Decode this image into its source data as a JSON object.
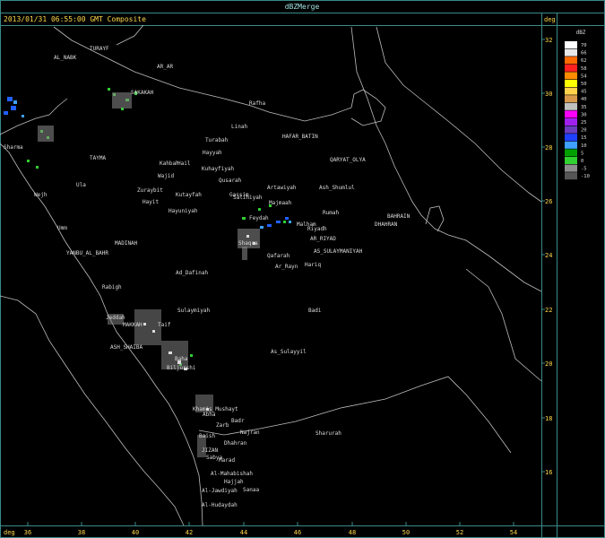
{
  "window": {
    "title": "dBZMerge"
  },
  "header": {
    "timestamp": "2013/01/31 06:55:00 GMT Composite",
    "unit_right": "deg"
  },
  "bottom_axis": {
    "unit": "deg",
    "ticks": [
      "36",
      "38",
      "40",
      "42",
      "44",
      "46",
      "48",
      "50",
      "52",
      "54"
    ]
  },
  "right_axis": {
    "ticks": [
      "32",
      "30",
      "28",
      "26",
      "24",
      "22",
      "20",
      "18",
      "16"
    ]
  },
  "legend": {
    "unit": "dBZ",
    "entries": [
      {
        "label": "70",
        "color": "#ffffff"
      },
      {
        "label": "66",
        "color": "#e8e8e8"
      },
      {
        "label": "62",
        "color": "#ff6a00"
      },
      {
        "label": "58",
        "color": "#ff2020"
      },
      {
        "label": "54",
        "color": "#ff8c00"
      },
      {
        "label": "50",
        "color": "#ffff00"
      },
      {
        "label": "45",
        "color": "#ffd24a"
      },
      {
        "label": "40",
        "color": "#d89a4a"
      },
      {
        "label": "35",
        "color": "#c0c0c0"
      },
      {
        "label": "30",
        "color": "#ff00ff"
      },
      {
        "label": "25",
        "color": "#a020f0"
      },
      {
        "label": "20",
        "color": "#6a3dbf"
      },
      {
        "label": "15",
        "color": "#2040ff"
      },
      {
        "label": "10",
        "color": "#3fa0ff"
      },
      {
        "label": "5",
        "color": "#00a000"
      },
      {
        "label": "0",
        "color": "#2fd02f"
      },
      {
        "label": "-5",
        "color": "#8c8c8c"
      },
      {
        "label": "-10",
        "color": "#555555"
      }
    ]
  },
  "places": [
    {
      "name": "TURAYF"
    },
    {
      "name": "AR_AR"
    },
    {
      "name": "AL_NABK"
    },
    {
      "name": "SAKAKAH"
    },
    {
      "name": "Rafha"
    },
    {
      "name": "Linah"
    },
    {
      "name": "Sharma"
    },
    {
      "name": "Turabah"
    },
    {
      "name": "Hayyah"
    },
    {
      "name": "HAFAR_BATIN"
    },
    {
      "name": "QARYAT_OLYA"
    },
    {
      "name": "TAYMA"
    },
    {
      "name": "Kahbah"
    },
    {
      "name": "Hail"
    },
    {
      "name": "Kuhayfiyah"
    },
    {
      "name": "Wajid"
    },
    {
      "name": "Qusarah"
    },
    {
      "name": "Artawiyah"
    },
    {
      "name": "Ash_Shumlul"
    },
    {
      "name": "Ula"
    },
    {
      "name": "Zuraybit"
    },
    {
      "name": "Kutayfah"
    },
    {
      "name": "Gassim"
    },
    {
      "name": "Wejh"
    },
    {
      "name": "Hayit"
    },
    {
      "name": "Hayuniyah"
    },
    {
      "name": "Feydah"
    },
    {
      "name": "Majmaah"
    },
    {
      "name": "Rumah"
    },
    {
      "name": "BAHRAIN"
    },
    {
      "name": "DHAHRAN"
    },
    {
      "name": "Umm"
    },
    {
      "name": "MADINAH"
    },
    {
      "name": "Malham"
    },
    {
      "name": "Riyadh"
    },
    {
      "name": "AR_RIYAD"
    },
    {
      "name": "YANBU_AL_BAHR"
    },
    {
      "name": "Shaqra"
    },
    {
      "name": "Qafarah"
    },
    {
      "name": "AS_SULAYMANIYAH"
    },
    {
      "name": "Hariq"
    },
    {
      "name": "Ad_Dafinah"
    },
    {
      "name": "Ar_Rayn"
    },
    {
      "name": "Rabigh"
    },
    {
      "name": "Sulaymiyah"
    },
    {
      "name": "Badi"
    },
    {
      "name": "Jeddah"
    },
    {
      "name": "MAKKAH"
    },
    {
      "name": "Taif"
    },
    {
      "name": "ASH_SHAIBA"
    },
    {
      "name": "As_Sulayyil"
    },
    {
      "name": "Biljurshi"
    },
    {
      "name": "Baha"
    },
    {
      "name": "Khamis_Mushayt"
    },
    {
      "name": "Abha"
    },
    {
      "name": "Badr"
    },
    {
      "name": "Zarb"
    },
    {
      "name": "Najran"
    },
    {
      "name": "Sharurah"
    },
    {
      "name": "Baish"
    },
    {
      "name": "Dhahran"
    },
    {
      "name": "JIZAN"
    },
    {
      "name": "Sabya"
    },
    {
      "name": "Marad"
    },
    {
      "name": "Al-Mahabishah"
    },
    {
      "name": "Hajjah"
    },
    {
      "name": "Al-Jawdiyah"
    },
    {
      "name": "Sanaa"
    },
    {
      "name": "Al-Hudaydah"
    },
    {
      "name": "Salihiyah"
    }
  ]
}
